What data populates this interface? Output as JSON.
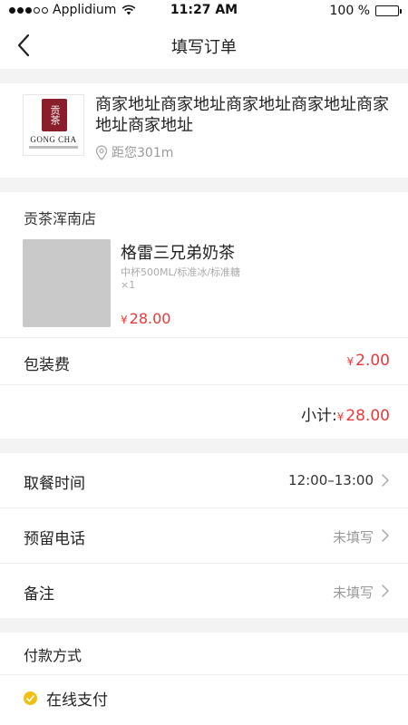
{
  "status_bar": {
    "carrier": "Applidium",
    "time": "11:27 AM",
    "battery": "100 %"
  },
  "nav": {
    "title": "填写订单"
  },
  "shop": {
    "logo_text": "GONG CHA",
    "logo_glyph": "贡茶",
    "address": "商家地址商家地址商家地址商家地址商家地址商家地址",
    "distance": "距您301m"
  },
  "order": {
    "store_name": "贡茶浑南店",
    "product": {
      "name": "格雷三兄弟奶茶",
      "spec": "中杯500ML/标准冰/标准糖",
      "qty": "×1",
      "currency": "¥",
      "price": "28.00"
    },
    "packaging": {
      "label": "包装费",
      "currency": "¥",
      "price": "2.00"
    },
    "subtotal": {
      "label": "小计:",
      "currency": "¥",
      "amount": "28.00"
    }
  },
  "options": [
    {
      "label": "取餐时间",
      "value": "12:00–13:00"
    },
    {
      "label": "预留电话",
      "value": "未填写"
    },
    {
      "label": "备注",
      "value": "未填写"
    }
  ],
  "payment": {
    "title": "付款方式",
    "selected": "在线支付"
  },
  "colors": {
    "price_red": "#e83a3a",
    "check_yellow": "#f2c012",
    "brand_maroon": "#8a1f2b"
  }
}
